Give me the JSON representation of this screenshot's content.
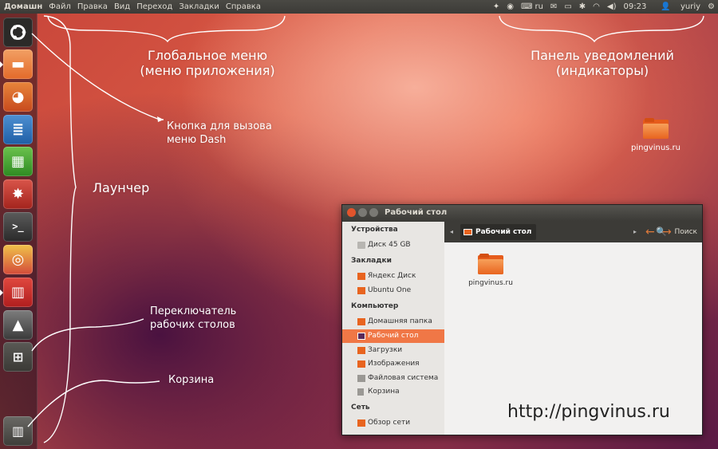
{
  "top_panel": {
    "menu": [
      "Домашн",
      "Файл",
      "Правка",
      "Вид",
      "Переход",
      "Закладки",
      "Справка"
    ],
    "indicators": {
      "keyboard_layout": "ru",
      "time": "09:23",
      "user": "yuriy"
    }
  },
  "annotations": {
    "global_menu": "Глобальное меню\n(меню приложения)",
    "indicators_panel": "Панель уведомлений\n(индикаторы)",
    "dash_button": "Кнопка для вызова\nменю Dash",
    "launcher": "Лаунчер",
    "workspace_switcher": "Переключатель\nрабочих столов",
    "trash": "Корзина"
  },
  "desktop": {
    "folder_label": "pingvinus.ru"
  },
  "file_manager": {
    "title": "Рабочий стол",
    "breadcrumb": "Рабочий стол",
    "search_label": "Поиск",
    "sidebar": {
      "devices_header": "Устройства",
      "devices": [
        "Диск 45 GB"
      ],
      "bookmarks_header": "Закладки",
      "bookmarks": [
        "Яндекс Диск",
        "Ubuntu One"
      ],
      "computer_header": "Компьютер",
      "computer": [
        "Домашняя папка",
        "Рабочий стол",
        "Загрузки",
        "Изображения",
        "Файловая система",
        "Корзина"
      ],
      "network_header": "Сеть",
      "network": [
        "Обзор сети"
      ]
    },
    "content_folder_label": "pingvinus.ru"
  },
  "watermark": "http://pingvinus.ru",
  "colors": {
    "accent": "#f07746",
    "panel": "#3c3b37"
  }
}
